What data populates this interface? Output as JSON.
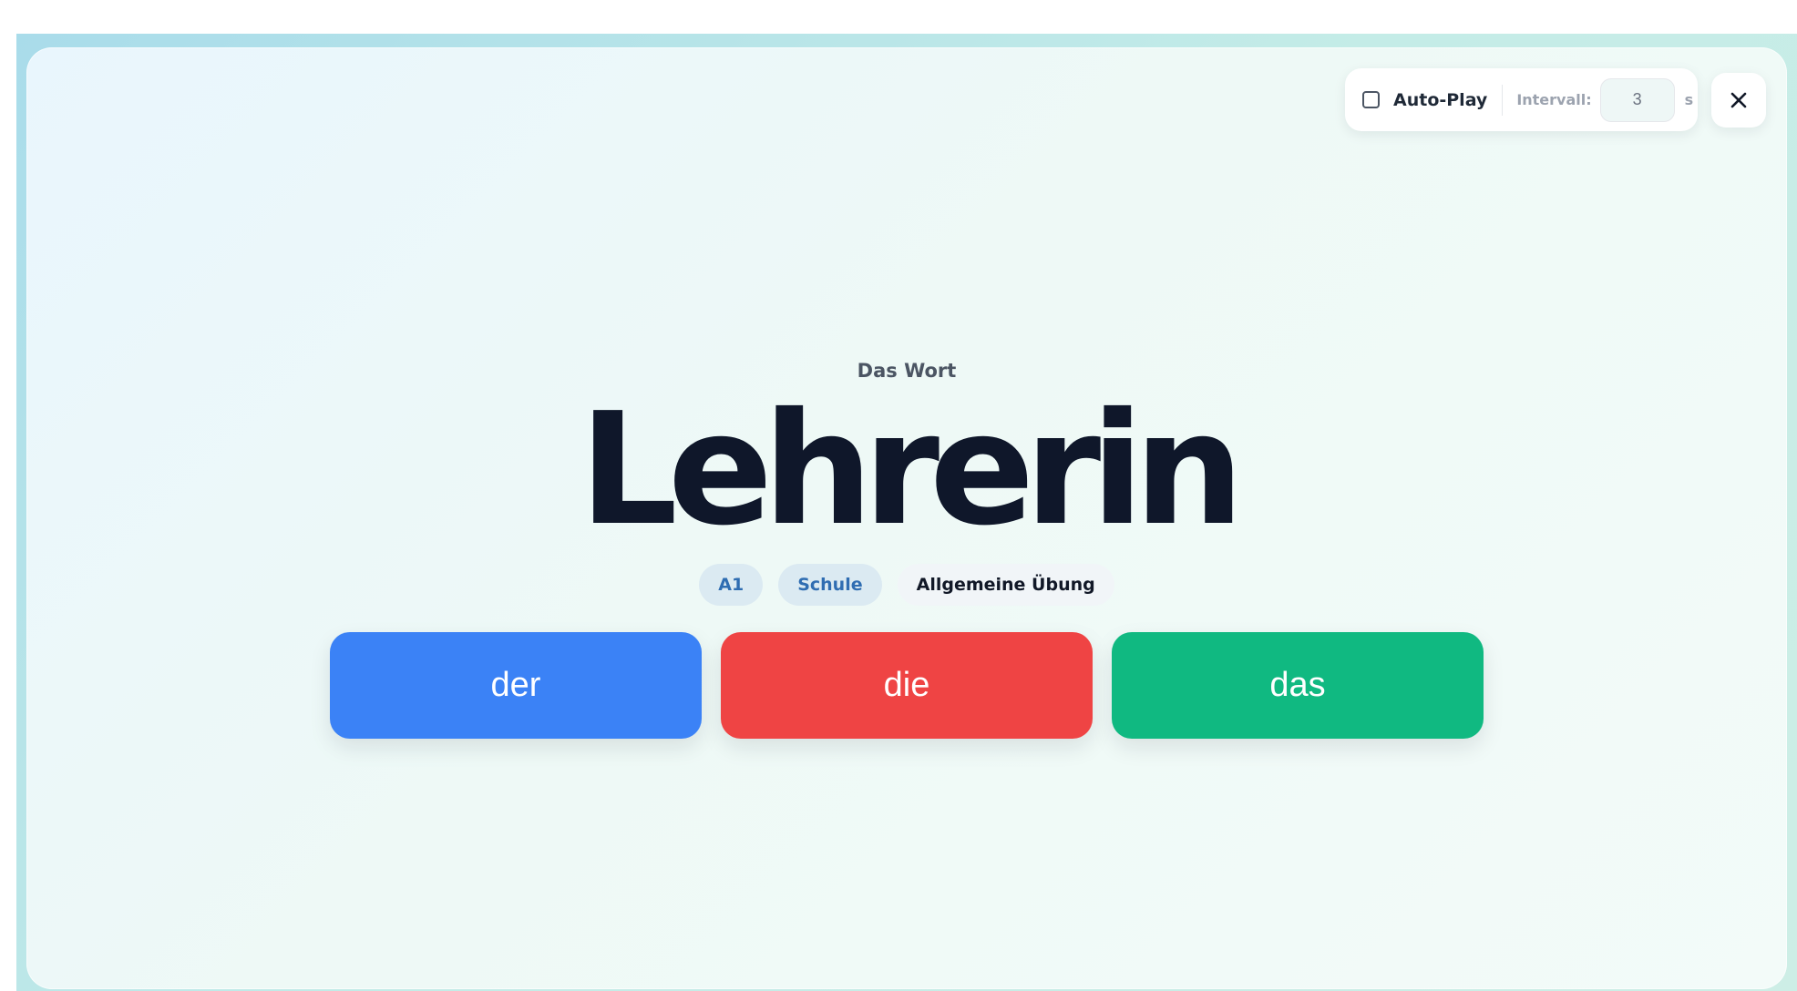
{
  "controls": {
    "autoplay": {
      "label": "Auto-Play",
      "checked": false
    },
    "interval": {
      "label": "Intervall:",
      "value": "3",
      "unit": "s"
    },
    "close_icon": "close-icon"
  },
  "card": {
    "subtitle": "Das Wort",
    "word": "Lehrerin",
    "tags": {
      "level": "A1",
      "topic": "Schule",
      "mode": "Allgemeine Übung"
    }
  },
  "articles": {
    "der": "der",
    "die": "die",
    "das": "das"
  },
  "colors": {
    "der": "#3b82f6",
    "die": "#ef4444",
    "das": "#10b981",
    "word": "#0f172a",
    "tag_accent": "#2f6db2"
  }
}
